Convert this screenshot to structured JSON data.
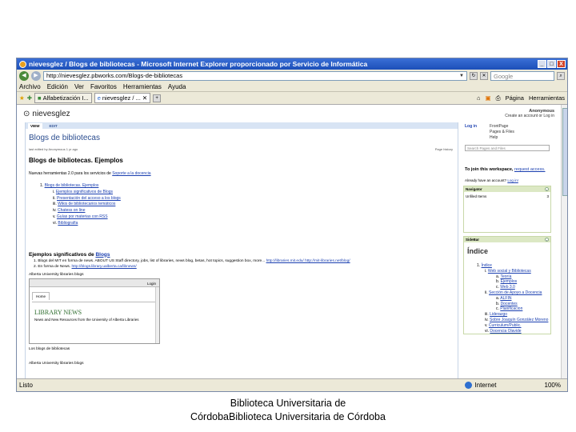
{
  "window": {
    "title": "nievesglez / Blogs de bibliotecas - Microsoft Internet Explorer proporcionado por Servicio de Informática",
    "buttons": [
      "_",
      "□",
      "X"
    ]
  },
  "address": {
    "url": "http://nievesglez.pbworks.com/Blogs-de-bibliotecas",
    "search_placeholder": "Google"
  },
  "menu": [
    "Archivo",
    "Edición",
    "Ver",
    "Favoritos",
    "Herramientas",
    "Ayuda"
  ],
  "tabs": [
    {
      "label": "Alfabetización I..."
    },
    {
      "label": "nievesglez / ..."
    }
  ],
  "toolbar": {
    "page_label": "Página",
    "tools_label": "Herramientas"
  },
  "page": {
    "workspace": "nievesglez",
    "anon": {
      "name": "Anonymous",
      "links": "Create an account or Log in"
    },
    "view_tab": "VIEW",
    "edit_tab": "EDIT",
    "title": "Blogs de bibliotecas",
    "edited": "last edited by Anonymous 1 yr ago",
    "page_history": "Page history",
    "heading": "Blogs de bibliotecas. Ejemplos",
    "nuevas_text": "Nuevas herramientas 2.0 para los servicios de",
    "nuevas_link": "Soporte a la docencia",
    "outline": [
      {
        "num": "1.",
        "text": "Blogs de bibliotecas. Ejemplos"
      },
      {
        "num": "i.",
        "text": "Ejemplos significativos de Blogs"
      },
      {
        "num": "ii.",
        "text": "Presentación del acceso a los blogs"
      },
      {
        "num": "iii.",
        "text": "Wikis de bibliotecarios temáticos"
      },
      {
        "num": "iv.",
        "text": "Chatess on line"
      },
      {
        "num": "v.",
        "text": "Guías por materias con RSS"
      },
      {
        "num": "vi.",
        "text": "Bibliografía"
      }
    ],
    "ejemplos_heading": "Ejemplos significativos de",
    "ejemplos_link": "Blogs",
    "blog_items": [
      {
        "num": "1.",
        "text": "Blogs del MIT en forma de news. ABOUT US  Staff directory, jobs, list of libraries, news blog, betas, hot topics, suggestion box, more...",
        "links": "http://libraries.mit.edu/ http://mit-libraries.net/blog/"
      },
      {
        "num": "2.",
        "text": "En forma de News.",
        "links": "http://blogs.library.ualberta.ca/libnews/"
      }
    ],
    "alberta_caption": "Alberta University libraries blogs",
    "shot": {
      "login": "Login",
      "home": "Home",
      "library_news": "LIBRARY NEWS",
      "subtitle": "News and New Resources from the University of Alberta Libraries"
    },
    "caption2": "Los blogs de bibliotecas",
    "caption3": "Alberta University libraries blogs"
  },
  "sidebar": {
    "login": "Log in",
    "links": [
      "FrontPage",
      "Pages & Files",
      "Help"
    ],
    "search_placeholder": "Search Pages and Files",
    "join_text": "To join this workspace,",
    "join_link": "request access.",
    "already": "Already have an account?",
    "already_link": "Log in!",
    "navigator_title": "Navigator",
    "navigator_item": "Unfiled Items",
    "navigator_count": "3",
    "sidebar_title": "SideBar",
    "indice_title": "Índice",
    "toc": [
      {
        "level": 1,
        "num": "1.",
        "text": "Índice"
      },
      {
        "level": 2,
        "num": "i.",
        "text": "Web social y Bibliotecas"
      },
      {
        "level": 3,
        "num": "a.",
        "text": "Teoría"
      },
      {
        "level": 3,
        "num": "b.",
        "text": "Ejemplos"
      },
      {
        "level": 3,
        "num": "c.",
        "text": "Web 3.0"
      },
      {
        "level": 2,
        "num": "ii.",
        "text": "Sección de Apoyo a Docencia"
      },
      {
        "level": 3,
        "num": "a.",
        "text": "ALFIN"
      },
      {
        "level": 3,
        "num": "b.",
        "text": "Docentes"
      },
      {
        "level": 3,
        "num": "c.",
        "text": "Planificacion"
      },
      {
        "level": 2,
        "num": "iii.",
        "text": "Liderazgo"
      },
      {
        "level": 2,
        "num": "iv.",
        "text": "Sobre Joaquín González Moreno"
      },
      {
        "level": 2,
        "num": "v.",
        "text": "Curriculum/Public."
      },
      {
        "level": 2,
        "num": "vi.",
        "text": "Docencia Olavide"
      }
    ]
  },
  "status": {
    "text": "Listo",
    "zone": "Internet",
    "zoom": "100%"
  },
  "footer": {
    "line1": "Biblioteca Universitaria de",
    "line2": "CórdobaBiblioteca Universitaria de Córdoba"
  }
}
